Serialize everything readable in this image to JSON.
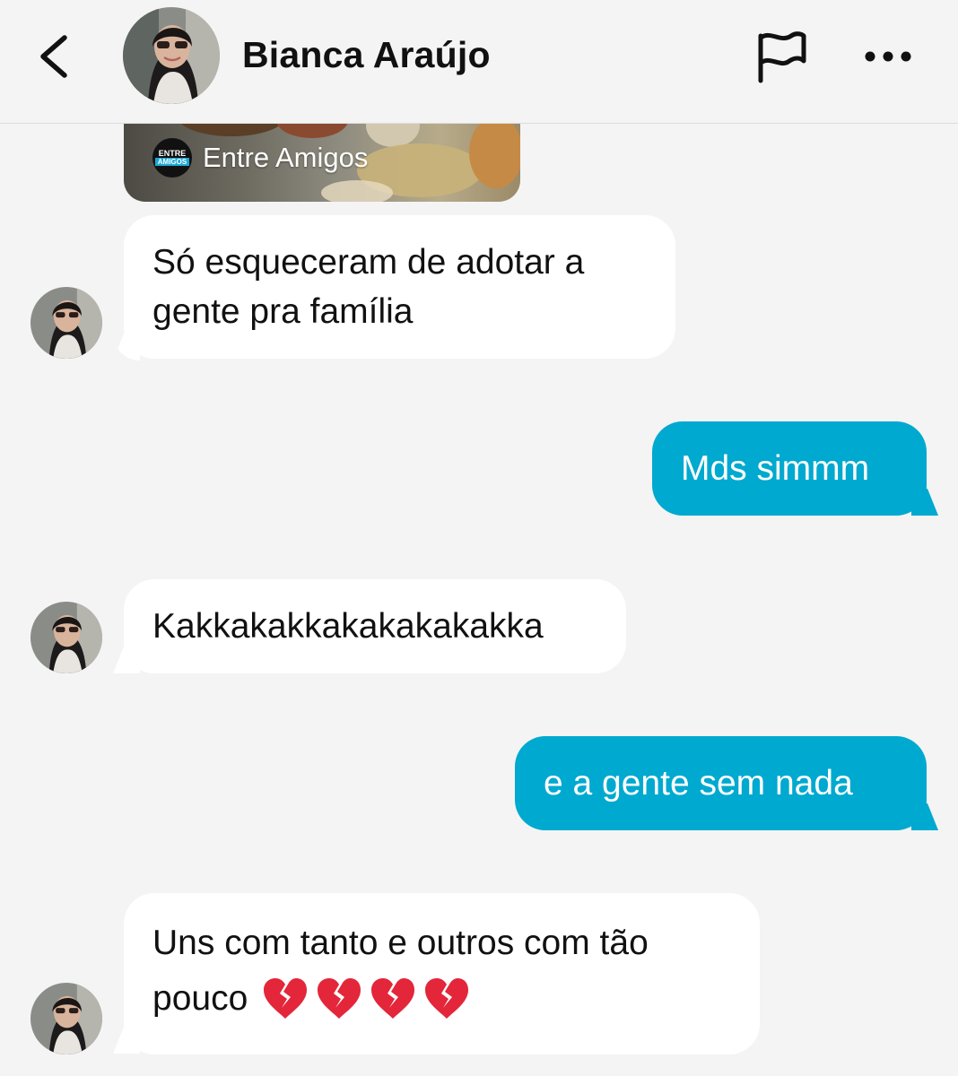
{
  "header": {
    "contact_name": "Bianca Araújo",
    "back_icon": "chevron-left-icon",
    "flag_icon": "flag-icon",
    "more_icon": "more-horizontal-icon"
  },
  "shared_card": {
    "source_name": "Entre Amigos",
    "logo_line1": "ENTRE",
    "logo_line2": "AMIGOS"
  },
  "messages": [
    {
      "direction": "incoming",
      "lines": [
        "Só esqueceram de adotar a",
        "gente pra família"
      ]
    },
    {
      "direction": "outgoing",
      "text": "Mds simmm"
    },
    {
      "direction": "incoming",
      "text": "Kakkakakkakakakakakka"
    },
    {
      "direction": "outgoing",
      "text": "e a gente sem nada"
    },
    {
      "direction": "incoming",
      "lines": [
        "Uns com tanto e outros com tão",
        "pouco"
      ],
      "emoji": "broken-heart-icon",
      "emoji_count": 4
    }
  ],
  "colors": {
    "background": "#f4f4f4",
    "incoming_bubble": "#ffffff",
    "outgoing_bubble": "#00a9cf",
    "emoji_heart": "#e3263a"
  }
}
